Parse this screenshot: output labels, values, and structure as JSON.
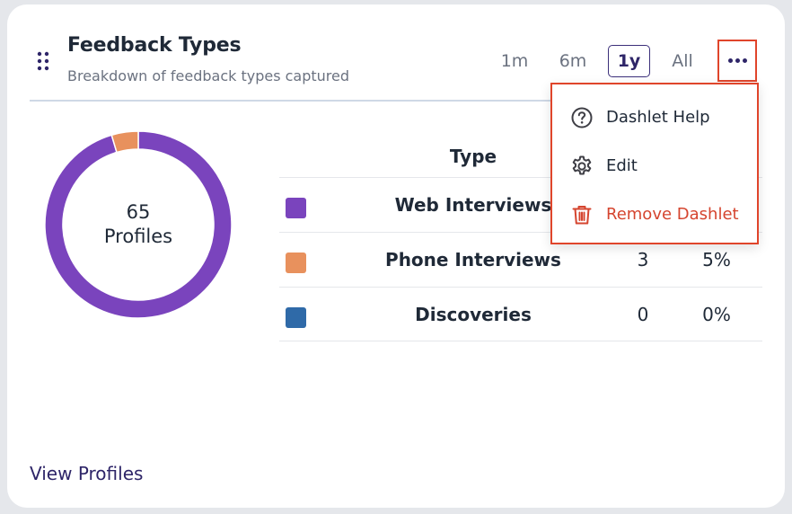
{
  "header": {
    "title": "Feedback Types",
    "subtitle": "Breakdown of feedback types captured",
    "ranges": [
      "1m",
      "6m",
      "1y",
      "All"
    ],
    "active_range": "1y"
  },
  "donut": {
    "total": "65",
    "unit": "Profiles",
    "segments": [
      {
        "name": "Web Interviews",
        "value": 62,
        "color": "#7a44bd"
      },
      {
        "name": "Phone Interviews",
        "value": 3,
        "color": "#e8915d"
      },
      {
        "name": "Discoveries",
        "value": 0,
        "color": "#2f6aa8"
      }
    ]
  },
  "table": {
    "header_type": "Type",
    "rows": [
      {
        "label": "Web Interviews",
        "count": "",
        "percent": "",
        "color": "#7a44bd"
      },
      {
        "label": "Phone Interviews",
        "count": "3",
        "percent": "5%",
        "color": "#e8915d"
      },
      {
        "label": "Discoveries",
        "count": "0",
        "percent": "0%",
        "color": "#2f6aa8"
      }
    ]
  },
  "menu": {
    "items": [
      {
        "label": "Dashlet Help",
        "icon": "help-circle-icon"
      },
      {
        "label": "Edit",
        "icon": "gear-icon"
      },
      {
        "label": "Remove Dashlet",
        "icon": "trash-icon"
      }
    ]
  },
  "footer": {
    "link_label": "View Profiles"
  },
  "colors": {
    "accent": "#2e2568",
    "highlight": "#e0452b",
    "danger": "#d5452f"
  }
}
